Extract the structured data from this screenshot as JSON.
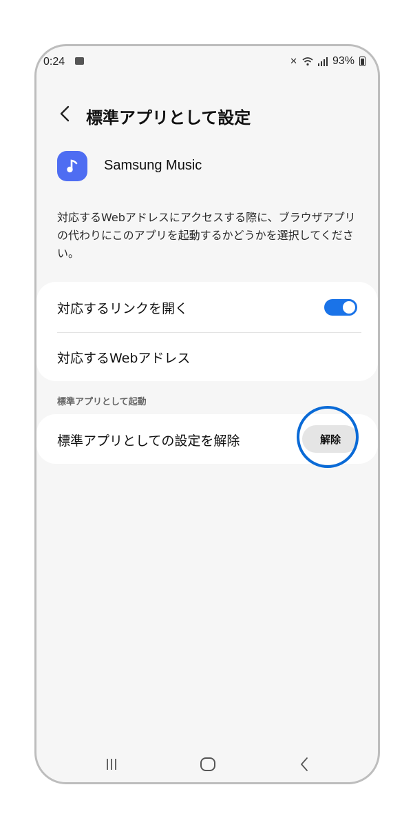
{
  "status_bar": {
    "time": "0:24",
    "battery": "93%",
    "icons": [
      "notification-icon",
      "mute-icon",
      "wifi-icon",
      "signal-icon",
      "battery-icon"
    ]
  },
  "header": {
    "back_icon": "chevron-left-icon",
    "title": "標準アプリとして設定"
  },
  "app": {
    "name": "Samsung Music",
    "icon": "music-note-icon",
    "icon_color": "#4e6df2"
  },
  "description": "対応するWebアドレスにアクセスする際に、ブラウザアプリの代わりにこのアプリを起動するかどうかを選択してください。",
  "links_card": {
    "open_links_label": "対応するリンクを開く",
    "open_links_enabled": true,
    "web_addresses_label": "対応するWebアドレス"
  },
  "default_section": {
    "header": "標準アプリとして起動",
    "clear_label": "標準アプリとしての設定を解除",
    "clear_button": "解除"
  },
  "colors": {
    "accent": "#1a73e8",
    "highlight_ring": "#0a6ad6",
    "background": "#f6f6f6"
  },
  "nav_bar": {
    "icons": [
      "recent-apps-icon",
      "home-icon",
      "back-icon"
    ]
  }
}
